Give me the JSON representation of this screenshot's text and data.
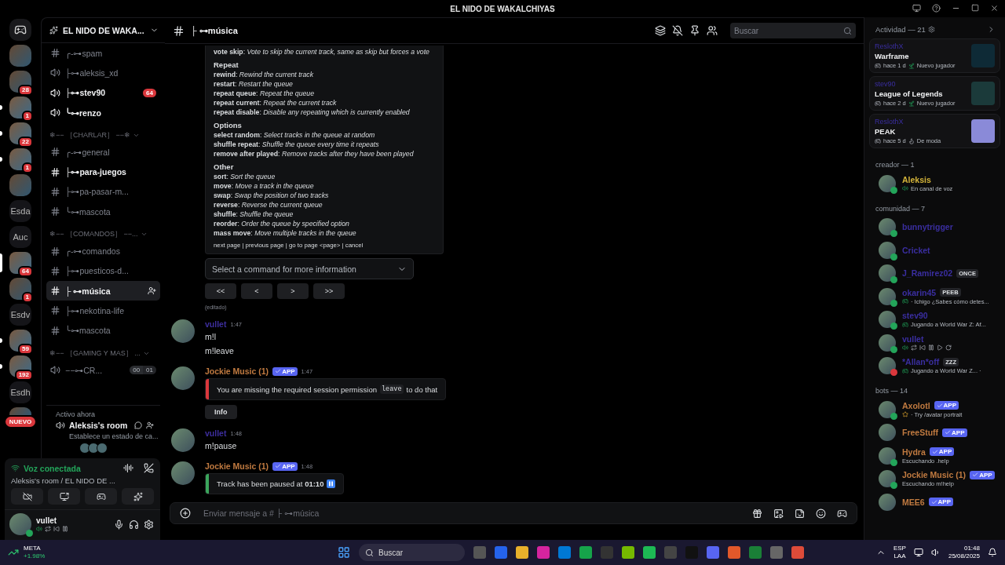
{
  "title_bar": {
    "title": "EL NIDO DE WAKALCHIYAS"
  },
  "server_rail": [
    {
      "kind": "logo",
      "selected": false,
      "unread": false
    },
    {
      "kind": "image",
      "selected": false,
      "unread": false
    },
    {
      "kind": "image",
      "badge": "28",
      "selected": false,
      "unread": false
    },
    {
      "kind": "image",
      "badge": "1",
      "selected": false,
      "unread": true
    },
    {
      "kind": "image",
      "badge": "22",
      "selected": false,
      "unread": true
    },
    {
      "kind": "image",
      "badge": "1",
      "selected": false,
      "unread": true
    },
    {
      "kind": "image",
      "selected": false,
      "unread": false
    },
    {
      "kind": "text",
      "label": "Esda",
      "selected": false,
      "unread": false
    },
    {
      "kind": "text",
      "label": "Auc",
      "selected": false,
      "unread": false
    },
    {
      "kind": "image",
      "badge": "64",
      "selected": true,
      "unread": false
    },
    {
      "kind": "image",
      "badge": "1",
      "selected": false,
      "unread": false
    },
    {
      "kind": "text",
      "label": "Esdv",
      "selected": false,
      "unread": false
    },
    {
      "kind": "image",
      "badge": "59",
      "selected": false,
      "unread": true
    },
    {
      "kind": "image",
      "badge": "192",
      "selected": false,
      "unread": true
    },
    {
      "kind": "text",
      "label": "Esdh",
      "selected": false,
      "unread": false
    },
    {
      "kind": "image",
      "new_label": "NUEVO",
      "selected": false,
      "unread": false
    }
  ],
  "server": {
    "name": "EL NIDO DE WAKA..."
  },
  "channels": [
    {
      "kind": "text",
      "name": "╭-⊶spam",
      "unread": false,
      "selected": false
    },
    {
      "kind": "voice",
      "name": "├⊶aleksis_xd",
      "unread": false,
      "selected": false
    },
    {
      "kind": "voice",
      "name": "├⊶stev90",
      "unread": true,
      "selected": false,
      "badge": "64"
    },
    {
      "kind": "voice",
      "name": "╰⊶renzo",
      "unread": true,
      "selected": false
    },
    {
      "kind": "category",
      "name": "❄−− ［CHARLAR］ −−❄"
    },
    {
      "kind": "text",
      "name": "╭-⊶general",
      "unread": false,
      "selected": false
    },
    {
      "kind": "text",
      "name": "├⊶para-juegos",
      "unread": true,
      "selected": false
    },
    {
      "kind": "text",
      "name": "├⊶pa-pasar-m...",
      "unread": false,
      "selected": false
    },
    {
      "kind": "text",
      "name": "╰⊶mascota",
      "unread": false,
      "selected": false
    },
    {
      "kind": "category",
      "name": "❄−− ［COMANDOS］ −−..."
    },
    {
      "kind": "text",
      "name": "╭-⊶comandos",
      "unread": false,
      "selected": false
    },
    {
      "kind": "text",
      "name": "├⊶puesticos-d...",
      "unread": false,
      "selected": false
    },
    {
      "kind": "text",
      "name": "├ ⊶música",
      "unread": true,
      "selected": true
    },
    {
      "kind": "text",
      "name": "├⊶nekotina-life",
      "unread": false,
      "selected": false
    },
    {
      "kind": "text",
      "name": "╰⊶mascota",
      "unread": false,
      "selected": false
    },
    {
      "kind": "category",
      "name": "❄−− ［GAMING Y MAS］ ..."
    },
    {
      "kind": "voice",
      "name": "−−⊶CR...",
      "unread": false,
      "selected": false,
      "counter": [
        "00",
        "01"
      ]
    }
  ],
  "active_now": {
    "heading": "Activo ahora",
    "room": "Aleksis's room",
    "status": "Establece un estado de ca..."
  },
  "voice_panel": {
    "status": "Voz conectada",
    "location": "Aleksis's room / EL NIDO DE ..."
  },
  "user_panel": {
    "name": "vullet"
  },
  "chat_header": {
    "channel": "├ ⊶música",
    "search_placeholder": "Buscar"
  },
  "help_embed": {
    "lines": [
      "**vote skip**: *Vote to skip the current track, same as skip but forces a vote*"
    ],
    "sections": [
      {
        "title": "Repeat",
        "lines": [
          "**rewind**: *Rewind the current track*",
          "**restart**: *Restart the queue*",
          "**repeat queue**: *Repeat the queue*",
          "**repeat current**: *Repeat the current track*",
          "**repeat disable**: *Disable any repeating which is currently enabled*"
        ]
      },
      {
        "title": "Options",
        "lines": [
          "**select random**: *Select tracks in the queue at random*",
          "**shuffle repeat**: *Shuffle the queue every time it repeats*",
          "**remove after played**: *Remove tracks after they have been played*"
        ]
      },
      {
        "title": "Other",
        "lines": [
          "**sort**: *Sort the queue*",
          "**move**: *Move a track in the queue*",
          "**swap**: *Swap the position of two tracks*",
          "**reverse**: *Reverse the current queue*",
          "**shuffle**: *Shuffle the queue*",
          "**reorder**: *Order the queue by specified option*",
          "**mass move**: *Move multiple tracks in the queue*"
        ]
      }
    ],
    "footer": "next page | previous page | go to page <page> | cancel"
  },
  "command_select": {
    "placeholder": "Select a command for more information"
  },
  "pager_buttons": [
    "<<",
    "<",
    ">",
    ">>"
  ],
  "edited": "(editado)",
  "messages": [
    {
      "author": "vullet",
      "color": "#3d2e9e",
      "time": "1:47",
      "lines": [
        "m!l",
        "m!leave"
      ]
    },
    {
      "author": "Jockie Music (1)",
      "color": "#c07a40",
      "app_tag": "APP",
      "time": "1:47",
      "embed": {
        "kind": "error",
        "color": "#da373c",
        "text": "You are missing the required session permission",
        "code": "leave",
        "text_after": "to do that"
      },
      "buttons": [
        "Info"
      ]
    },
    {
      "author": "vullet",
      "color": "#3d2e9e",
      "time": "1:48",
      "lines": [
        "m!pause"
      ]
    },
    {
      "author": "Jockie Music (1)",
      "color": "#c07a40",
      "app_tag": "APP",
      "time": "1:48",
      "embed": {
        "kind": "paused",
        "color": "#3ba55c",
        "text": "Track has been paused at **01:10**"
      }
    }
  ],
  "composer": {
    "placeholder": "Enviar mensaje a # ├ ⊶música"
  },
  "members": {
    "activity_heading": "Actividad — 21",
    "activities": [
      {
        "user": "ReslothX",
        "game": "Warframe",
        "time": "hace 1 d",
        "tag": "Nuevo jugador",
        "kind": "new"
      },
      {
        "user": "stev90",
        "game": "League of Legends",
        "time": "hace 2 d",
        "tag": "Nuevo jugador",
        "kind": "new"
      },
      {
        "user": "ReslothX",
        "game": "PEAK",
        "time": "hace 5 d",
        "tag": "De moda",
        "kind": "trending"
      }
    ],
    "groups": [
      {
        "title": "creador — 1",
        "members": [
          {
            "name": "Aleksis",
            "color": "#d4b43a",
            "online": true,
            "dnd": false,
            "activity": "En canal de voz",
            "kind": "voice"
          }
        ]
      },
      {
        "title": "comunidad — 7",
        "members": [
          {
            "name": "bunnytrigger",
            "color": "#3a2ea0",
            "online": true,
            "dnd": false
          },
          {
            "name": "Cricket",
            "color": "#3a2ea0",
            "online": true,
            "dnd": false
          },
          {
            "name": "J_Ramirez02",
            "color": "#3a2ea0",
            "online": true,
            "dnd": false,
            "tag": "ONCE"
          },
          {
            "name": "okarin45",
            "color": "#3a2ea0",
            "online": true,
            "dnd": false,
            "tag": "PEEB",
            "activity": "· Ichigo ¿Sabes cómo detes...",
            "kind": "game"
          },
          {
            "name": "stev90",
            "color": "#3a2ea0",
            "online": true,
            "dnd": false,
            "activity": "Jugando a World War Z: Af...",
            "kind": "game"
          },
          {
            "name": "vullet",
            "color": "#3a2ea0",
            "online": true,
            "dnd": false,
            "kind": "media"
          },
          {
            "name": "*Allan*off",
            "color": "#3a2ea0",
            "online": true,
            "dnd": true,
            "tag": "ZZZ",
            "activity": "Jugando a World War Z... ·",
            "kind": "game"
          }
        ]
      },
      {
        "title": "bots — 14",
        "members": [
          {
            "name": "Axolotl",
            "color": "#c07a40",
            "online": true,
            "dnd": false,
            "app_tag": "APP",
            "activity": "· Try /avatar portrait",
            "kind": "star"
          },
          {
            "name": "FreeStuff",
            "color": "#c07a40",
            "online": false,
            "app_tag": "APP"
          },
          {
            "name": "Hydra",
            "color": "#c07a40",
            "online": true,
            "dnd": false,
            "app_tag": "APP",
            "activity": "Escuchando .help",
            "kind": "plain"
          },
          {
            "name": "Jockie Music (1)",
            "color": "#c07a40",
            "online": true,
            "dnd": false,
            "app_tag": "APP",
            "activity": "Escuchando m!help",
            "kind": "plain"
          },
          {
            "name": "MEE6",
            "color": "#c07a40",
            "online": false,
            "app_tag": "APP"
          }
        ]
      }
    ]
  },
  "taskbar": {
    "ticker": "META",
    "change": "+1.98%",
    "search_placeholder": "Buscar",
    "lang": "ESP",
    "layout": "LAA",
    "time": "01:48",
    "date": "25/08/2025"
  }
}
